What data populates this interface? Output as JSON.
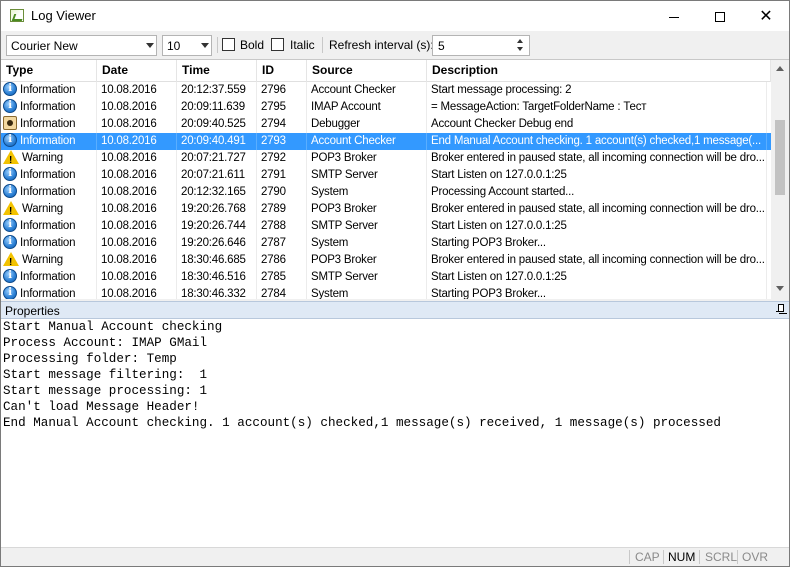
{
  "window": {
    "title": "Log Viewer"
  },
  "toolbar": {
    "font_name": "Courier New",
    "font_size": "10",
    "bold_label": "Bold",
    "bold_checked": false,
    "italic_label": "Italic",
    "italic_checked": false,
    "refresh_label": "Refresh interval (s):",
    "refresh_value": "5"
  },
  "grid": {
    "columns": [
      "Type",
      "Date",
      "Time",
      "ID",
      "Source",
      "Description"
    ],
    "rows": [
      {
        "icon": "info-icon",
        "type": "Information",
        "date": "10.08.2016",
        "time": "20:12:37.559",
        "id": "2796",
        "source": "Account Checker",
        "desc": "Start message processing: 2",
        "selected": false
      },
      {
        "icon": "info-icon",
        "type": "Information",
        "date": "10.08.2016",
        "time": "20:09:11.639",
        "id": "2795",
        "source": "IMAP Account",
        "desc": "= MessageAction: TargetFolderName : Тест",
        "selected": false
      },
      {
        "icon": "debug-icon",
        "type": "Information",
        "date": "10.08.2016",
        "time": "20:09:40.525",
        "id": "2794",
        "source": "Debugger",
        "desc": "Account Checker Debug end",
        "selected": false
      },
      {
        "icon": "info-icon",
        "type": "Information",
        "date": "10.08.2016",
        "time": "20:09:40.491",
        "id": "2793",
        "source": "Account Checker",
        "desc": "End Manual Account checking. 1 account(s) checked,1 message(...",
        "selected": true
      },
      {
        "icon": "warning-icon",
        "type": "Warning",
        "date": "10.08.2016",
        "time": "20:07:21.727",
        "id": "2792",
        "source": "POP3 Broker",
        "desc": "Broker entered in paused state, all incoming connection will be dro...",
        "selected": false
      },
      {
        "icon": "info-icon",
        "type": "Information",
        "date": "10.08.2016",
        "time": "20:07:21.611",
        "id": "2791",
        "source": "SMTP Server",
        "desc": "Start Listen on 127.0.0.1:25",
        "selected": false
      },
      {
        "icon": "info-icon",
        "type": "Information",
        "date": "10.08.2016",
        "time": "20:12:32.165",
        "id": "2790",
        "source": "System",
        "desc": "Processing Account started...",
        "selected": false
      },
      {
        "icon": "warning-icon",
        "type": "Warning",
        "date": "10.08.2016",
        "time": "19:20:26.768",
        "id": "2789",
        "source": "POP3 Broker",
        "desc": "Broker entered in paused state, all incoming connection will be dro...",
        "selected": false
      },
      {
        "icon": "info-icon",
        "type": "Information",
        "date": "10.08.2016",
        "time": "19:20:26.744",
        "id": "2788",
        "source": "SMTP Server",
        "desc": "Start Listen on 127.0.0.1:25",
        "selected": false
      },
      {
        "icon": "info-icon",
        "type": "Information",
        "date": "10.08.2016",
        "time": "19:20:26.646",
        "id": "2787",
        "source": "System",
        "desc": "Starting POP3 Broker...",
        "selected": false
      },
      {
        "icon": "warning-icon",
        "type": "Warning",
        "date": "10.08.2016",
        "time": "18:30:46.685",
        "id": "2786",
        "source": "POP3 Broker",
        "desc": "Broker entered in paused state, all incoming connection will be dro...",
        "selected": false
      },
      {
        "icon": "info-icon",
        "type": "Information",
        "date": "10.08.2016",
        "time": "18:30:46.516",
        "id": "2785",
        "source": "SMTP Server",
        "desc": "Start Listen on 127.0.0.1:25",
        "selected": false
      },
      {
        "icon": "info-icon",
        "type": "Information",
        "date": "10.08.2016",
        "time": "18:30:46.332",
        "id": "2784",
        "source": "System",
        "desc": "Starting POP3 Broker...",
        "selected": false
      }
    ]
  },
  "properties": {
    "title": "Properties",
    "lines": [
      "Start Manual Account checking",
      "Process Account: IMAP GMail",
      "Processing folder: Temp",
      "Start message filtering:  1",
      "Start message processing: 1",
      "Can't load Message Header!",
      "End Manual Account checking. 1 account(s) checked,1 message(s) received, 1 message(s) processed"
    ]
  },
  "statusbar": {
    "cap": "CAP",
    "num": "NUM",
    "scrl": "SCRL",
    "ovr": "OVR"
  },
  "colors": {
    "selection": "#3399ff",
    "panel_header": "#dfe9f5"
  }
}
